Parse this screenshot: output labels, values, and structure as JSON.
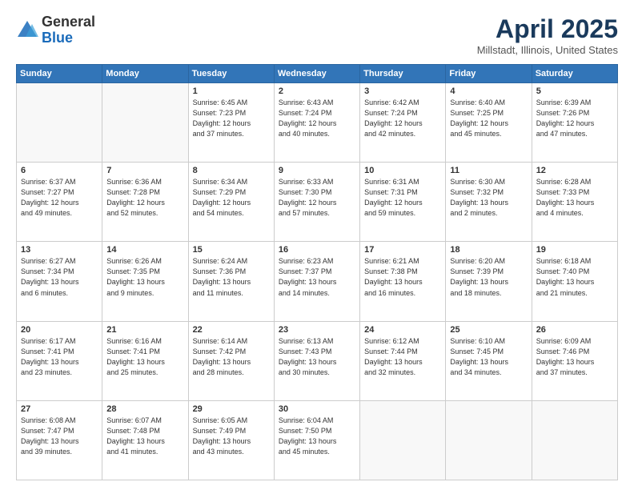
{
  "header": {
    "logo_general": "General",
    "logo_blue": "Blue",
    "title": "April 2025",
    "location": "Millstadt, Illinois, United States"
  },
  "days_of_week": [
    "Sunday",
    "Monday",
    "Tuesday",
    "Wednesday",
    "Thursday",
    "Friday",
    "Saturday"
  ],
  "weeks": [
    [
      {
        "day": "",
        "info": ""
      },
      {
        "day": "",
        "info": ""
      },
      {
        "day": "1",
        "info": "Sunrise: 6:45 AM\nSunset: 7:23 PM\nDaylight: 12 hours\nand 37 minutes."
      },
      {
        "day": "2",
        "info": "Sunrise: 6:43 AM\nSunset: 7:24 PM\nDaylight: 12 hours\nand 40 minutes."
      },
      {
        "day": "3",
        "info": "Sunrise: 6:42 AM\nSunset: 7:24 PM\nDaylight: 12 hours\nand 42 minutes."
      },
      {
        "day": "4",
        "info": "Sunrise: 6:40 AM\nSunset: 7:25 PM\nDaylight: 12 hours\nand 45 minutes."
      },
      {
        "day": "5",
        "info": "Sunrise: 6:39 AM\nSunset: 7:26 PM\nDaylight: 12 hours\nand 47 minutes."
      }
    ],
    [
      {
        "day": "6",
        "info": "Sunrise: 6:37 AM\nSunset: 7:27 PM\nDaylight: 12 hours\nand 49 minutes."
      },
      {
        "day": "7",
        "info": "Sunrise: 6:36 AM\nSunset: 7:28 PM\nDaylight: 12 hours\nand 52 minutes."
      },
      {
        "day": "8",
        "info": "Sunrise: 6:34 AM\nSunset: 7:29 PM\nDaylight: 12 hours\nand 54 minutes."
      },
      {
        "day": "9",
        "info": "Sunrise: 6:33 AM\nSunset: 7:30 PM\nDaylight: 12 hours\nand 57 minutes."
      },
      {
        "day": "10",
        "info": "Sunrise: 6:31 AM\nSunset: 7:31 PM\nDaylight: 12 hours\nand 59 minutes."
      },
      {
        "day": "11",
        "info": "Sunrise: 6:30 AM\nSunset: 7:32 PM\nDaylight: 13 hours\nand 2 minutes."
      },
      {
        "day": "12",
        "info": "Sunrise: 6:28 AM\nSunset: 7:33 PM\nDaylight: 13 hours\nand 4 minutes."
      }
    ],
    [
      {
        "day": "13",
        "info": "Sunrise: 6:27 AM\nSunset: 7:34 PM\nDaylight: 13 hours\nand 6 minutes."
      },
      {
        "day": "14",
        "info": "Sunrise: 6:26 AM\nSunset: 7:35 PM\nDaylight: 13 hours\nand 9 minutes."
      },
      {
        "day": "15",
        "info": "Sunrise: 6:24 AM\nSunset: 7:36 PM\nDaylight: 13 hours\nand 11 minutes."
      },
      {
        "day": "16",
        "info": "Sunrise: 6:23 AM\nSunset: 7:37 PM\nDaylight: 13 hours\nand 14 minutes."
      },
      {
        "day": "17",
        "info": "Sunrise: 6:21 AM\nSunset: 7:38 PM\nDaylight: 13 hours\nand 16 minutes."
      },
      {
        "day": "18",
        "info": "Sunrise: 6:20 AM\nSunset: 7:39 PM\nDaylight: 13 hours\nand 18 minutes."
      },
      {
        "day": "19",
        "info": "Sunrise: 6:18 AM\nSunset: 7:40 PM\nDaylight: 13 hours\nand 21 minutes."
      }
    ],
    [
      {
        "day": "20",
        "info": "Sunrise: 6:17 AM\nSunset: 7:41 PM\nDaylight: 13 hours\nand 23 minutes."
      },
      {
        "day": "21",
        "info": "Sunrise: 6:16 AM\nSunset: 7:41 PM\nDaylight: 13 hours\nand 25 minutes."
      },
      {
        "day": "22",
        "info": "Sunrise: 6:14 AM\nSunset: 7:42 PM\nDaylight: 13 hours\nand 28 minutes."
      },
      {
        "day": "23",
        "info": "Sunrise: 6:13 AM\nSunset: 7:43 PM\nDaylight: 13 hours\nand 30 minutes."
      },
      {
        "day": "24",
        "info": "Sunrise: 6:12 AM\nSunset: 7:44 PM\nDaylight: 13 hours\nand 32 minutes."
      },
      {
        "day": "25",
        "info": "Sunrise: 6:10 AM\nSunset: 7:45 PM\nDaylight: 13 hours\nand 34 minutes."
      },
      {
        "day": "26",
        "info": "Sunrise: 6:09 AM\nSunset: 7:46 PM\nDaylight: 13 hours\nand 37 minutes."
      }
    ],
    [
      {
        "day": "27",
        "info": "Sunrise: 6:08 AM\nSunset: 7:47 PM\nDaylight: 13 hours\nand 39 minutes."
      },
      {
        "day": "28",
        "info": "Sunrise: 6:07 AM\nSunset: 7:48 PM\nDaylight: 13 hours\nand 41 minutes."
      },
      {
        "day": "29",
        "info": "Sunrise: 6:05 AM\nSunset: 7:49 PM\nDaylight: 13 hours\nand 43 minutes."
      },
      {
        "day": "30",
        "info": "Sunrise: 6:04 AM\nSunset: 7:50 PM\nDaylight: 13 hours\nand 45 minutes."
      },
      {
        "day": "",
        "info": ""
      },
      {
        "day": "",
        "info": ""
      },
      {
        "day": "",
        "info": ""
      }
    ]
  ]
}
